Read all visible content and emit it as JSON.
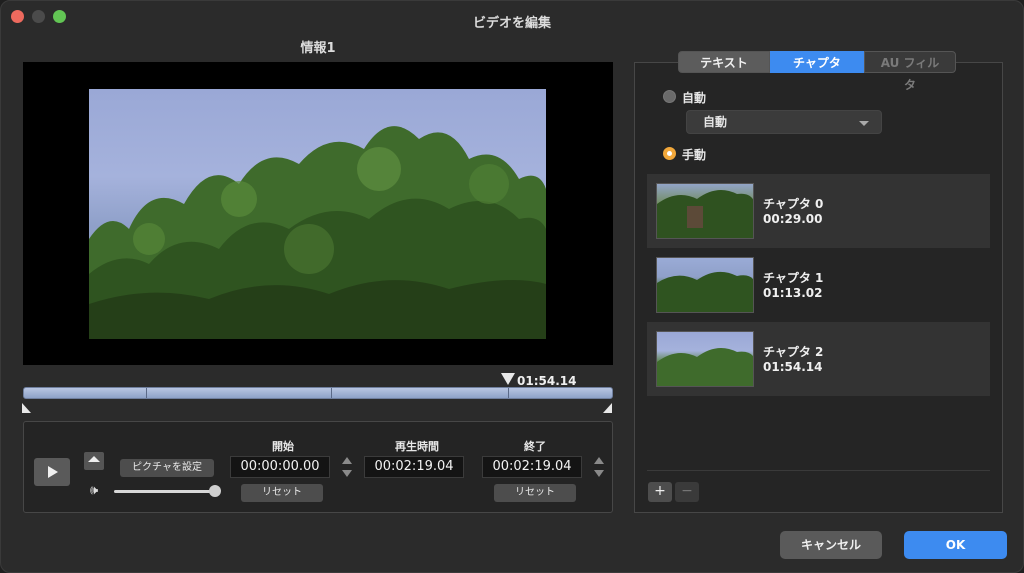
{
  "window": {
    "title": "ビデオを編集"
  },
  "video": {
    "title": "情報1",
    "current_time": "01:54.14"
  },
  "controls": {
    "set_picture_label": "ピクチャを設定",
    "start_label": "開始",
    "start_value": "00:00:00.00",
    "duration_label": "再生時間",
    "duration_value": "00:02:19.04",
    "end_label": "終了",
    "end_value": "00:02:19.04",
    "reset_label": "リセット",
    "volume_icon": "🕪",
    "volume_level": 0.9
  },
  "tabs": [
    {
      "label": "テキスト"
    },
    {
      "label": "チャプタ"
    },
    {
      "label": "AU フィルタ"
    }
  ],
  "chapter_mode": {
    "auto_label": "自動",
    "auto_select_value": "自動",
    "manual_label": "手動",
    "selected": "manual"
  },
  "chapters": [
    {
      "name": "チャプタ 0",
      "time": "00:29.00"
    },
    {
      "name": "チャプタ 1",
      "time": "01:13.02"
    },
    {
      "name": "チャプタ 2",
      "time": "01:54.14"
    }
  ],
  "list_buttons": {
    "add": "+",
    "remove": "−"
  },
  "footer": {
    "cancel_label": "キャンセル",
    "ok_label": "OK"
  },
  "colors": {
    "accent": "#3d8bf0",
    "radio_selected": "#f2a83b",
    "background": "#2b2b2b"
  }
}
